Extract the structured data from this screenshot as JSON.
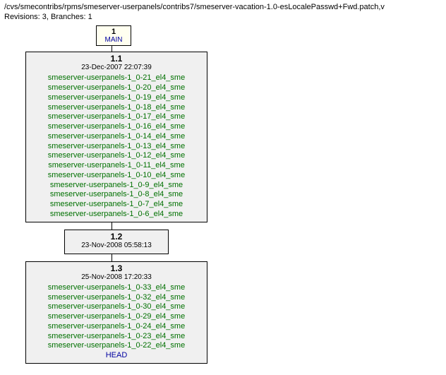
{
  "path": "/cvs/smecontribs/rpms/smeserver-userpanels/contribs7/smeserver-vacation-1.0-esLocalePasswd+Fwd.patch,v",
  "revisions_line": "Revisions: 3, Branches: 1",
  "branch": {
    "number": "1",
    "name": "MAIN"
  },
  "nodes": [
    {
      "number": "1.1",
      "date": "23-Dec-2007 22:07:39",
      "tags": [
        "smeserver-userpanels-1_0-21_el4_sme",
        "smeserver-userpanels-1_0-20_el4_sme",
        "smeserver-userpanels-1_0-19_el4_sme",
        "smeserver-userpanels-1_0-18_el4_sme",
        "smeserver-userpanels-1_0-17_el4_sme",
        "smeserver-userpanels-1_0-16_el4_sme",
        "smeserver-userpanels-1_0-14_el4_sme",
        "smeserver-userpanels-1_0-13_el4_sme",
        "smeserver-userpanels-1_0-12_el4_sme",
        "smeserver-userpanels-1_0-11_el4_sme",
        "smeserver-userpanels-1_0-10_el4_sme",
        "smeserver-userpanels-1_0-9_el4_sme",
        "smeserver-userpanels-1_0-8_el4_sme",
        "smeserver-userpanels-1_0-7_el4_sme",
        "smeserver-userpanels-1_0-6_el4_sme"
      ],
      "head": false,
      "wide": true
    },
    {
      "number": "1.2",
      "date": "23-Nov-2008 05:58:13",
      "tags": [],
      "head": false,
      "wide": false
    },
    {
      "number": "1.3",
      "date": "25-Nov-2008 17:20:33",
      "tags": [
        "smeserver-userpanels-1_0-33_el4_sme",
        "smeserver-userpanels-1_0-32_el4_sme",
        "smeserver-userpanels-1_0-30_el4_sme",
        "smeserver-userpanels-1_0-29_el4_sme",
        "smeserver-userpanels-1_0-24_el4_sme",
        "smeserver-userpanels-1_0-23_el4_sme",
        "smeserver-userpanels-1_0-22_el4_sme"
      ],
      "head": true,
      "head_label": "HEAD",
      "wide": true
    }
  ]
}
